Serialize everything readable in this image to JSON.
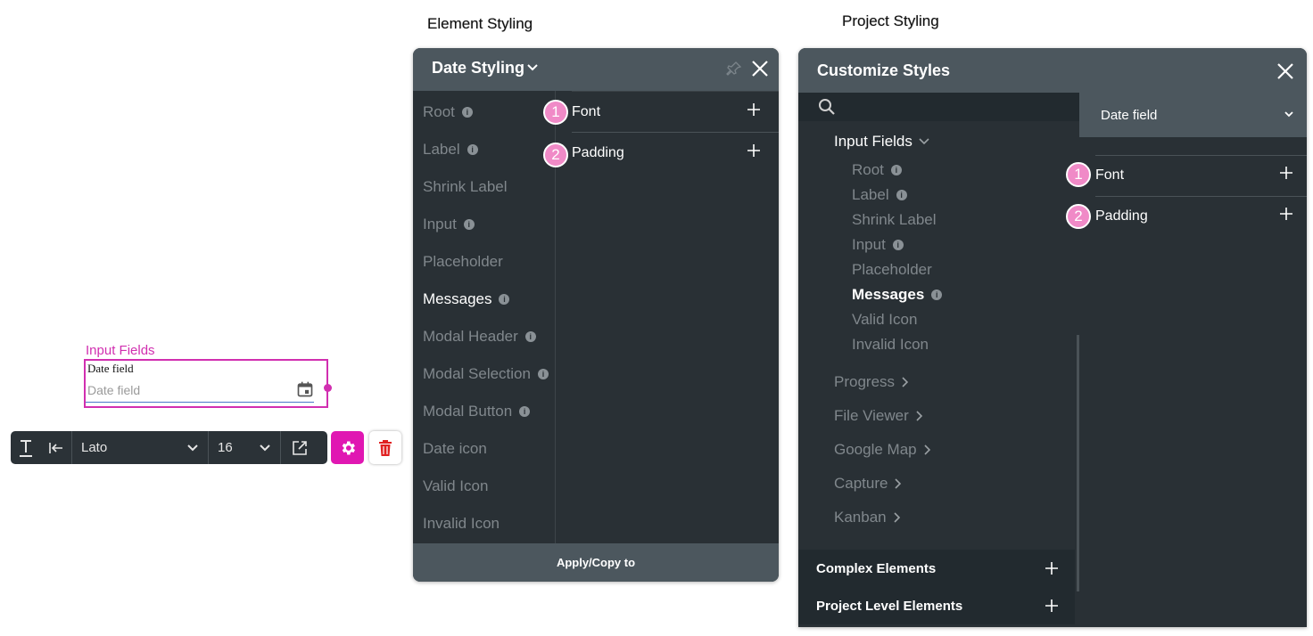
{
  "captions": {
    "element_styling": "Element Styling",
    "project_styling": "Project Styling"
  },
  "widget": {
    "group_label": "Input Fields",
    "field_label": "Date field",
    "placeholder": "Date field",
    "icon": "calendar-icon"
  },
  "toolbar": {
    "font": "Lato",
    "size": "16",
    "icons": [
      "text-style-icon",
      "align-left-icon",
      "chevron-down-icon",
      "external-link-icon",
      "gear-icon",
      "trash-icon"
    ]
  },
  "element_styling": {
    "title": "Date Styling",
    "items": [
      {
        "label": "Root",
        "info": true,
        "active": false
      },
      {
        "label": "Label",
        "info": true,
        "active": false
      },
      {
        "label": "Shrink Label",
        "info": false,
        "active": false
      },
      {
        "label": "Input",
        "info": true,
        "active": false
      },
      {
        "label": "Placeholder",
        "info": false,
        "active": false
      },
      {
        "label": "Messages",
        "info": true,
        "active": true
      },
      {
        "label": "Modal Header",
        "info": true,
        "active": false
      },
      {
        "label": "Modal Selection",
        "info": true,
        "active": false
      },
      {
        "label": "Modal Button",
        "info": true,
        "active": false
      },
      {
        "label": "Date icon",
        "info": false,
        "active": false
      },
      {
        "label": "Valid Icon",
        "info": false,
        "active": false
      },
      {
        "label": "Invalid Icon",
        "info": false,
        "active": false
      }
    ],
    "properties": [
      {
        "badge": "1",
        "label": "Font"
      },
      {
        "badge": "2",
        "label": "Padding"
      }
    ],
    "footer": "Apply/Copy to"
  },
  "project_styling": {
    "title": "Customize Styles",
    "tree_head": "Input Fields",
    "tree_items": [
      {
        "label": "Root",
        "info": true,
        "active": false
      },
      {
        "label": "Label",
        "info": true,
        "active": false
      },
      {
        "label": "Shrink Label",
        "info": false,
        "active": false
      },
      {
        "label": "Input",
        "info": true,
        "active": false
      },
      {
        "label": "Placeholder",
        "info": false,
        "active": false
      },
      {
        "label": "Messages",
        "info": true,
        "active": true
      },
      {
        "label": "Valid Icon",
        "info": false,
        "active": false
      },
      {
        "label": "Invalid Icon",
        "info": false,
        "active": false
      }
    ],
    "groups": [
      "Progress",
      "File Viewer",
      "Google Map",
      "Capture",
      "Kanban"
    ],
    "sections": [
      "Complex Elements",
      "Project Level Elements"
    ],
    "dropdown": "Date field",
    "properties": [
      {
        "badge": "1",
        "label": "Font"
      },
      {
        "badge": "2",
        "label": "Padding"
      }
    ]
  },
  "colors": {
    "accent": "#e017b2",
    "panel_bg": "#293035",
    "header_bg": "#4c575e",
    "badge": "#f08ac7"
  }
}
